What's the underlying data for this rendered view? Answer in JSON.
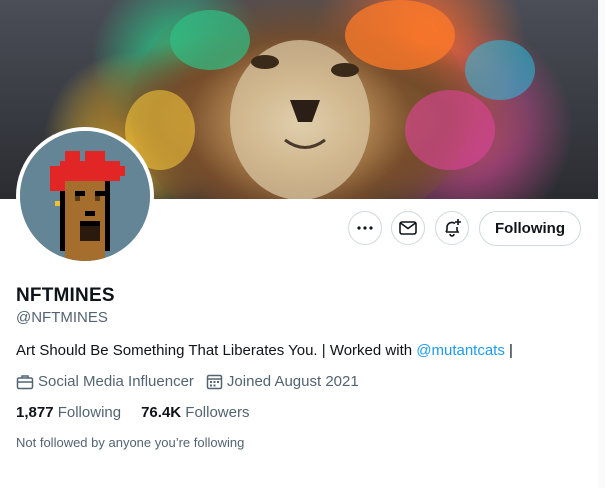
{
  "profile": {
    "name": "NFTMINES",
    "handle": "@NFTMINES",
    "bio_text": "Art Should Be Something That Liberates You. | Worked with ",
    "bio_mention": "@mutantcats",
    "bio_suffix": " |",
    "category": "Social Media Influencer",
    "joined": "Joined August 2021",
    "following_count": "1,877",
    "following_label": "Following",
    "followers_count": "76.4K",
    "followers_label": "Followers",
    "followed_by_note": "Not followed by anyone you’re following"
  },
  "actions": {
    "more_icon": "more-icon",
    "message_icon": "mail-icon",
    "notify_icon": "bell-plus-icon",
    "follow_label": "Following"
  },
  "colors": {
    "link": "#1d9bf0",
    "secondary_text": "#536471",
    "primary_text": "#0f1419",
    "border": "#cfd9de"
  }
}
